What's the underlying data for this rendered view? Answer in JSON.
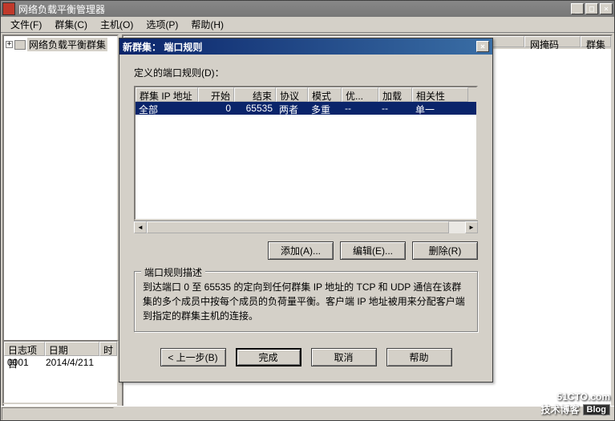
{
  "main": {
    "title": "网络负载平衡管理器",
    "menu": [
      "文件(F)",
      "群集(C)",
      "主机(O)",
      "选项(P)",
      "帮助(H)"
    ],
    "tree_root": "网络负载平衡群集",
    "right_cols": {
      "netmask": "网掩码",
      "mode": "群集模式"
    },
    "log_cols": {
      "item": "日志项目",
      "date": "日期",
      "time": "时"
    },
    "log_row": {
      "item": "0001",
      "date": "2014/4/21",
      "time": "1"
    }
  },
  "dialog": {
    "title": "新群集： 端口规则",
    "section_label": "定义的端口规则(D)：",
    "cols": {
      "ip": "群集 IP 地址",
      "start": "开始",
      "end": "结束",
      "proto": "协议",
      "mode": "模式",
      "prio": "优...",
      "load": "加载",
      "affinity": "相关性"
    },
    "row": {
      "ip": "全部",
      "start": "0",
      "end": "65535",
      "proto": "两者",
      "mode": "多重",
      "prio": "--",
      "load": "--",
      "affinity": "单一"
    },
    "buttons": {
      "add": "添加(A)...",
      "edit": "编辑(E)...",
      "remove": "删除(R)"
    },
    "group_title": "端口规则描述",
    "description": "到达端口 0 至 65535 的定向到任何群集 IP 地址的 TCP 和 UDP 通信在该群集的多个成员中按每个成员的负荷量平衡。客户端 IP 地址被用来分配客户端到指定的群集主机的连接。",
    "wizard": {
      "back": "< 上一步(B)",
      "finish": "完成",
      "cancel": "取消",
      "help": "帮助"
    }
  },
  "watermark": {
    "main": "51CTO.com",
    "sub": "技术博客",
    "tag": "Blog"
  }
}
